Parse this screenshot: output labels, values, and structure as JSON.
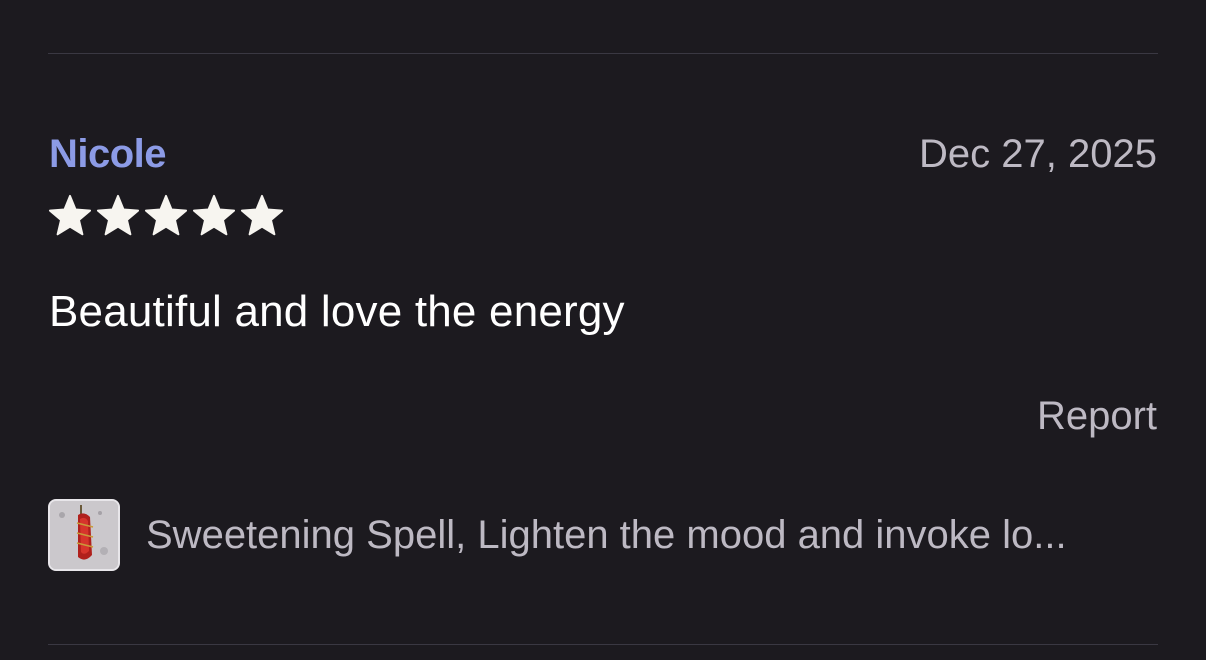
{
  "review": {
    "reviewer_name": "Nicole",
    "date": "Dec 27, 2025",
    "rating": 5,
    "rating_max": 5,
    "text": "Beautiful and love the energy",
    "report_label": "Report"
  },
  "product": {
    "title": "Sweetening Spell, Lighten the mood and invoke lo...",
    "thumbnail_icon": "crystal-pendant-thumbnail"
  },
  "colors": {
    "background": "#1c1a1f",
    "reviewer_name": "#8c9be6",
    "secondary_text": "#bdb9c3",
    "primary_text": "#ffffff",
    "star": "#f7f5f0",
    "divider": "#3a3842"
  }
}
